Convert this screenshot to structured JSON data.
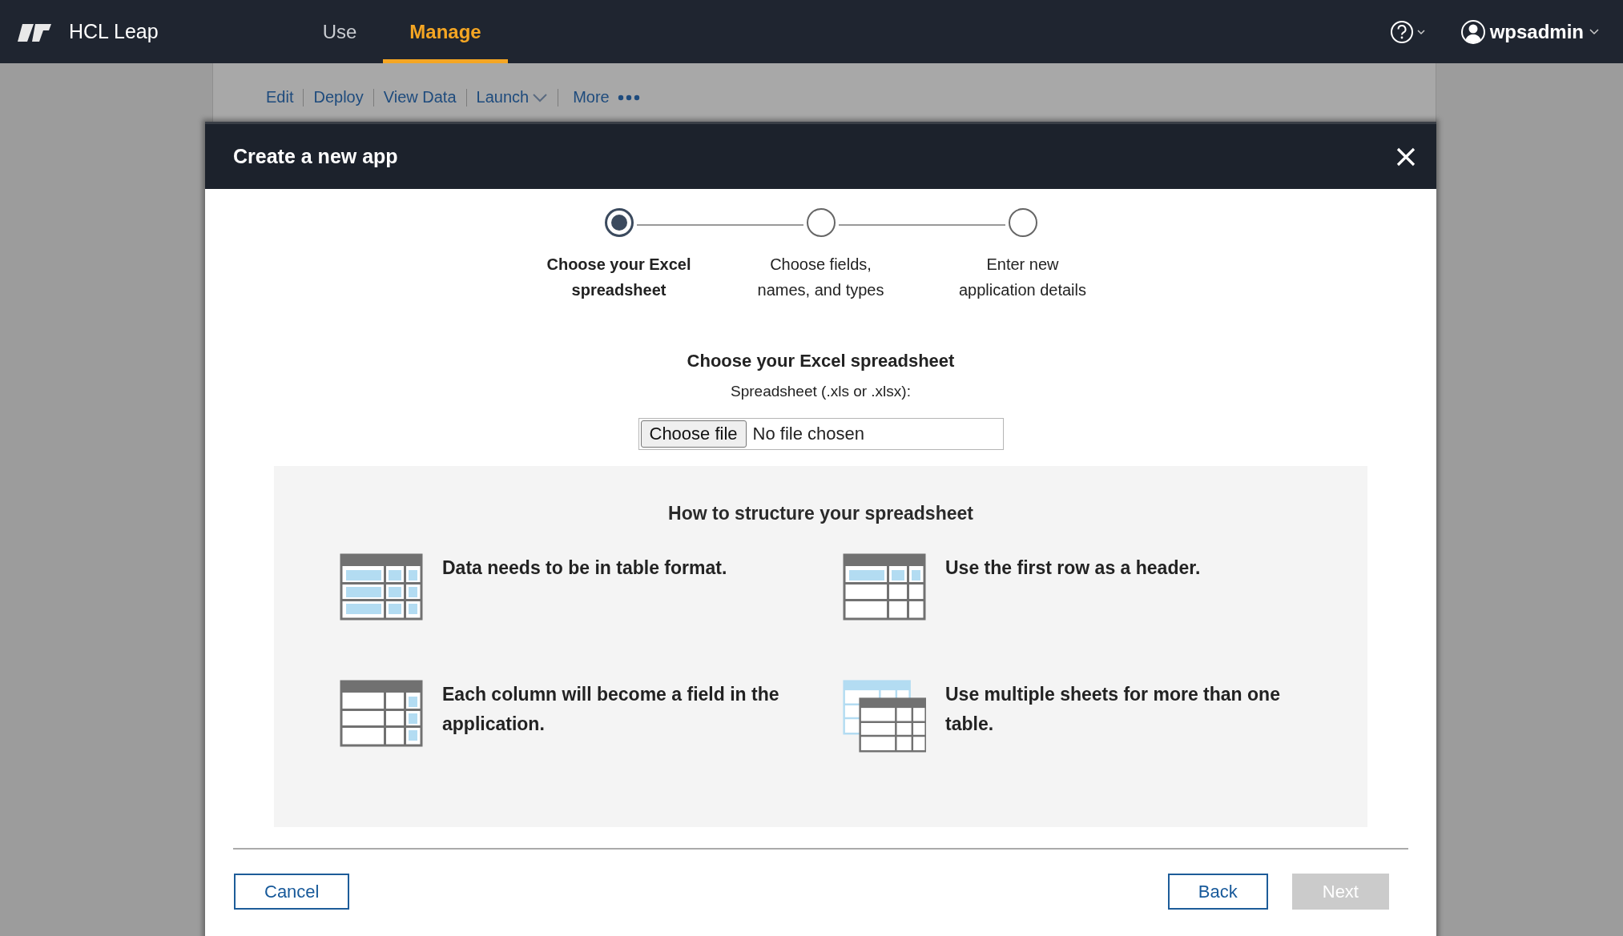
{
  "topbar": {
    "brand": "HCL Leap",
    "tabs": [
      {
        "label": "Use",
        "selected": false
      },
      {
        "label": "Manage",
        "selected": true
      }
    ],
    "user": "wpsadmin"
  },
  "background_page": {
    "actions": [
      {
        "label": "Edit",
        "kind": "link"
      },
      {
        "label": "Deploy",
        "kind": "link"
      },
      {
        "label": "View Data",
        "kind": "link"
      },
      {
        "label": "Launch",
        "kind": "dropdown"
      },
      {
        "label": "More",
        "kind": "more"
      }
    ]
  },
  "dialog": {
    "title": "Create a new app",
    "steps": [
      {
        "label": "Choose your Excel spreadsheet",
        "selected": true
      },
      {
        "label": "Choose fields, names, and types",
        "selected": false
      },
      {
        "label": "Enter new application details",
        "selected": false
      }
    ],
    "heading": "Choose your Excel spreadsheet",
    "file_label": "Spreadsheet (.xls or .xlsx):",
    "file_button": "Choose file",
    "file_status": "No file chosen",
    "tips_title": "How to structure your spreadsheet",
    "tips": [
      {
        "kind": "table",
        "text": "Data needs to be in table format."
      },
      {
        "kind": "header",
        "text": "Use the first row as a header."
      },
      {
        "kind": "column",
        "text": "Each column will become a field in the application."
      },
      {
        "kind": "sheets",
        "text": "Use multiple sheets for more than one table."
      }
    ],
    "buttons": [
      {
        "label": "Cancel",
        "kind": "secondary",
        "disabled": false
      },
      {
        "label": "Back",
        "kind": "secondary",
        "disabled": false
      },
      {
        "label": "Next",
        "kind": "primary",
        "disabled": true
      }
    ]
  }
}
